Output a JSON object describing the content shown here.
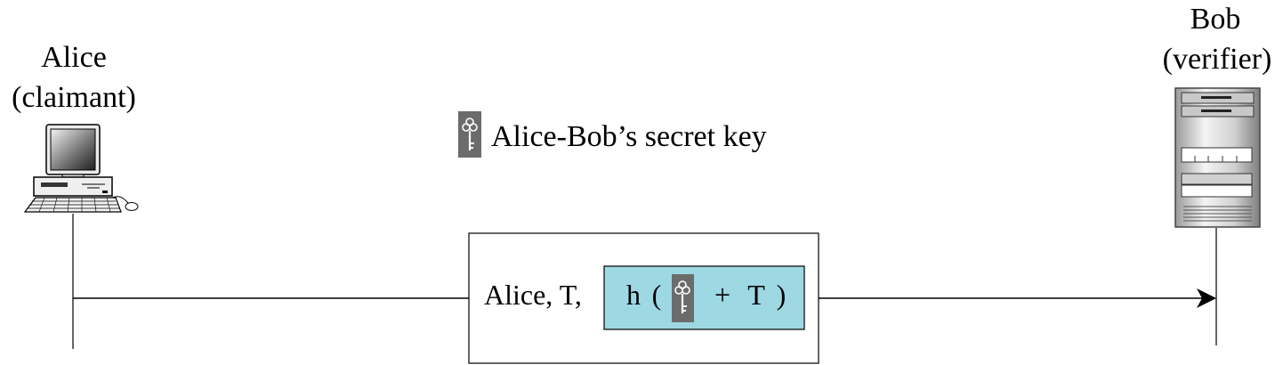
{
  "alice": {
    "name": "Alice",
    "role": "(claimant)",
    "icon": "desktop-computer-icon"
  },
  "bob": {
    "name": "Bob",
    "role": "(verifier)",
    "icon": "server-tower-icon"
  },
  "shared_key": {
    "label": "Alice-Bob’s secret key",
    "icon": "key-icon"
  },
  "message": {
    "prefix": "Alice, T,",
    "hash": {
      "fn": "h",
      "open": "(",
      "plus": "+",
      "t": "T",
      "close": ")",
      "icon": "key-icon"
    }
  },
  "colors": {
    "line": "#000000",
    "hash_fill": "#9dd8e3",
    "key_bg": "#6b6b6b"
  }
}
